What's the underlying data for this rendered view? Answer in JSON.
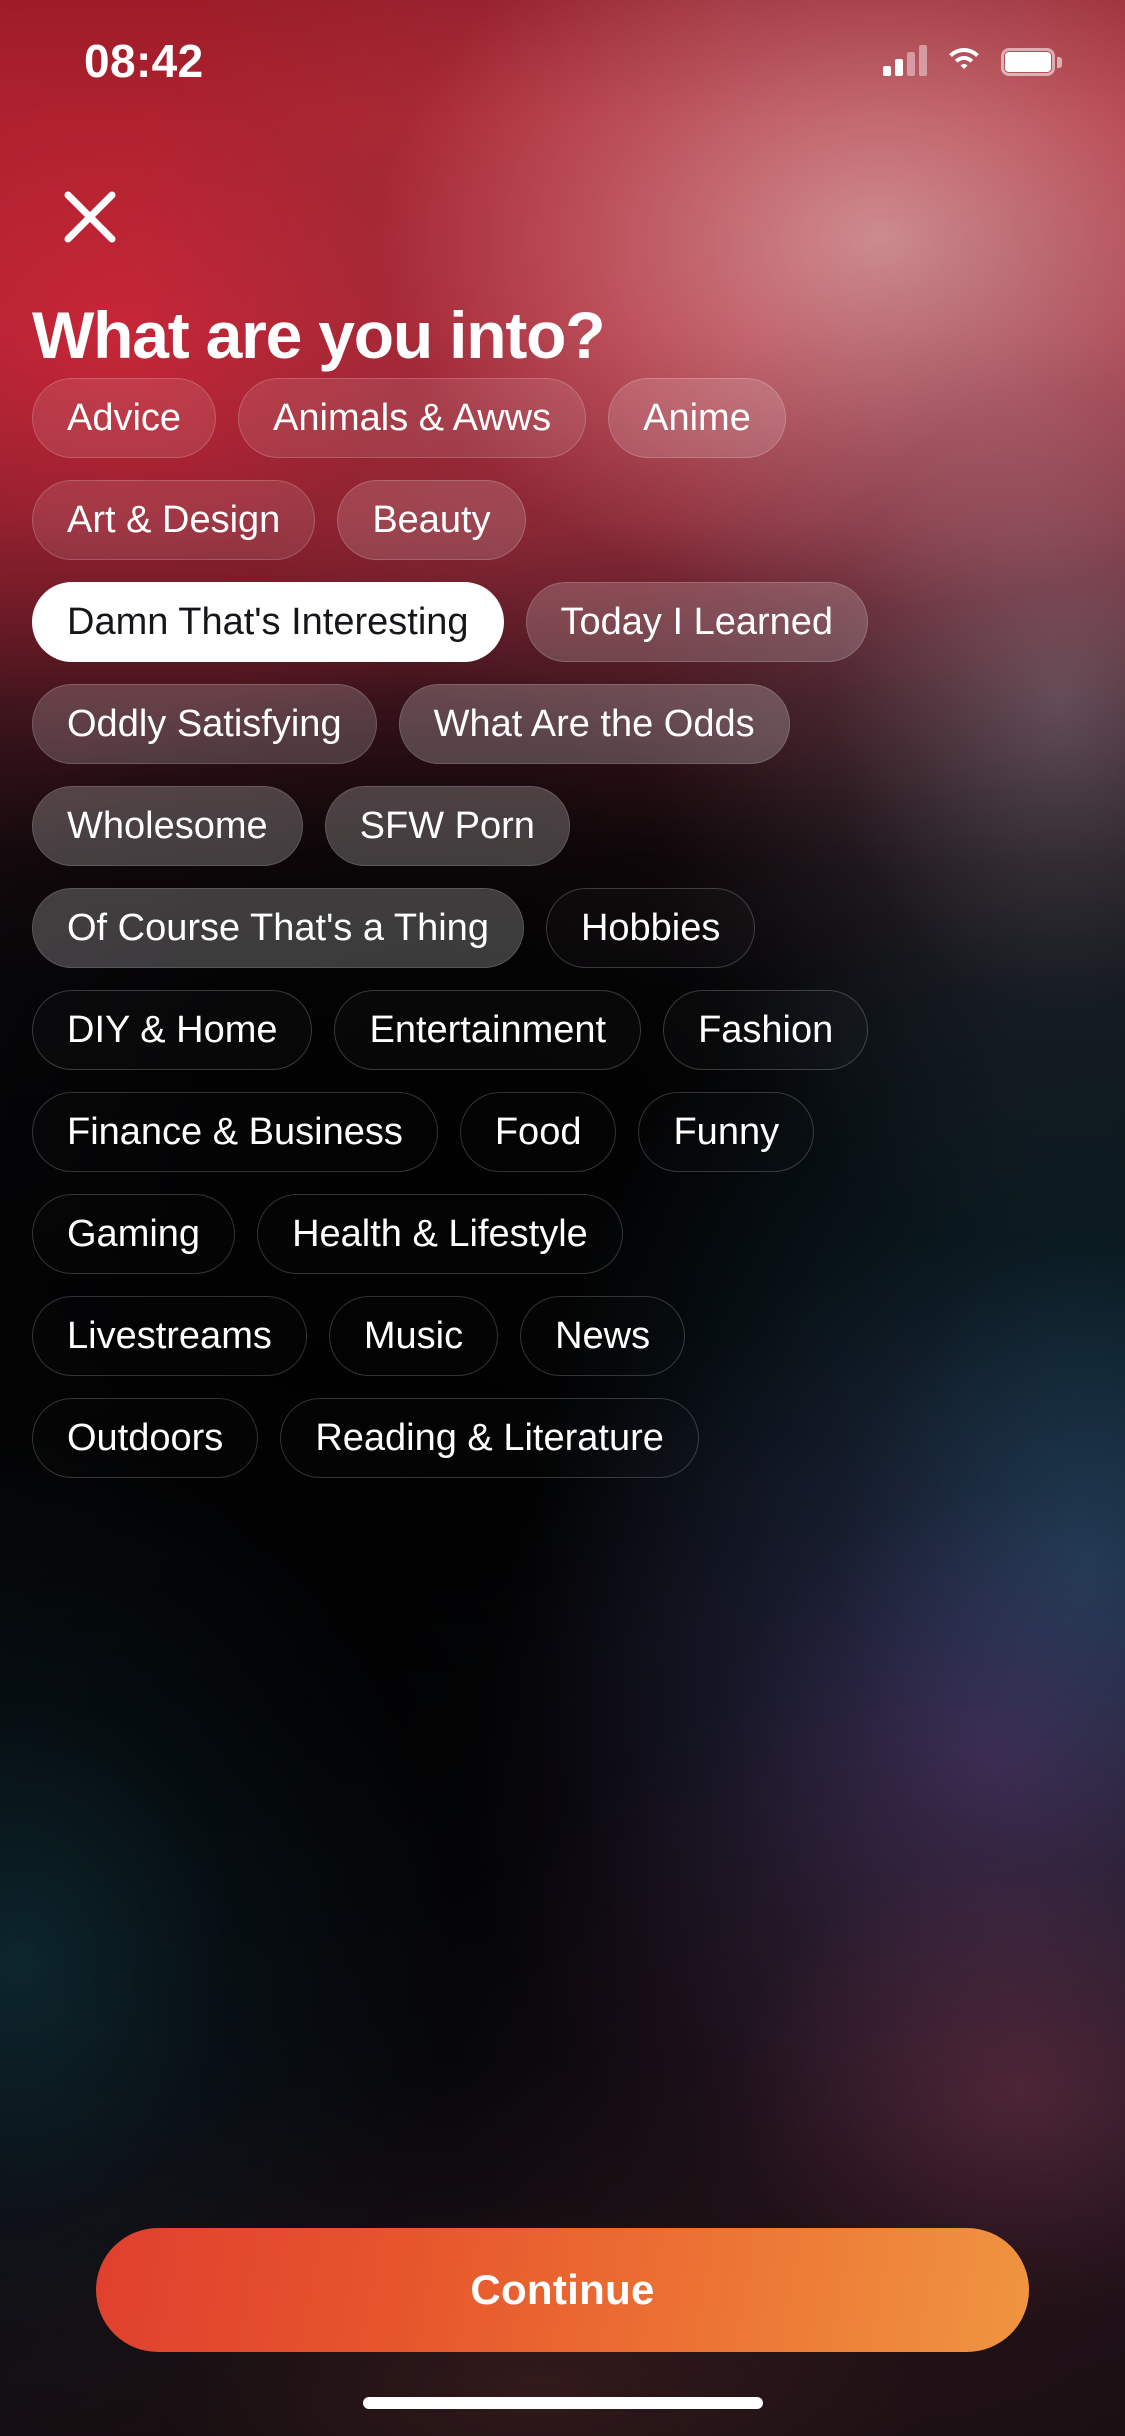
{
  "status_bar": {
    "time": "08:42",
    "cellular_icon": "signal-bars-icon",
    "wifi_icon": "wifi-icon",
    "battery_icon": "battery-full-icon"
  },
  "header": {
    "close_icon": "close-icon",
    "title": "What are you into?"
  },
  "interests": {
    "rows": [
      [
        {
          "label": "Advice",
          "selected": false,
          "fill": "f10"
        },
        {
          "label": "Animals & Awws",
          "selected": false,
          "fill": "f10"
        },
        {
          "label": "Anime",
          "selected": false,
          "fill": "f14"
        }
      ],
      [
        {
          "label": "Art & Design",
          "selected": false,
          "fill": "f10"
        },
        {
          "label": "Beauty",
          "selected": false,
          "fill": "f14"
        }
      ],
      [
        {
          "label": "Damn That's Interesting",
          "selected": true,
          "fill": "selected"
        },
        {
          "label": "Today I Learned",
          "selected": false,
          "fill": "f18"
        }
      ],
      [
        {
          "label": "Oddly Satisfying",
          "selected": false,
          "fill": "f18"
        },
        {
          "label": "What Are the Odds",
          "selected": false,
          "fill": "f22"
        }
      ],
      [
        {
          "label": "Wholesome",
          "selected": false,
          "fill": "f22"
        },
        {
          "label": "SFW Porn",
          "selected": false,
          "fill": "f22"
        }
      ],
      [
        {
          "label": "Of Course That's a Thing",
          "selected": false,
          "fill": "f22"
        },
        {
          "label": "Hobbies",
          "selected": false,
          "fill": "f02"
        }
      ],
      [
        {
          "label": "DIY & Home",
          "selected": false,
          "fill": "f02"
        },
        {
          "label": "Entertainment",
          "selected": false,
          "fill": "f02"
        },
        {
          "label": "Fashion",
          "selected": false,
          "fill": "f02"
        }
      ],
      [
        {
          "label": "Finance & Business",
          "selected": false,
          "fill": "f01"
        },
        {
          "label": "Food",
          "selected": false,
          "fill": "f01"
        },
        {
          "label": "Funny",
          "selected": false,
          "fill": "f01"
        }
      ],
      [
        {
          "label": "Gaming",
          "selected": false,
          "fill": "f01"
        },
        {
          "label": "Health & Lifestyle",
          "selected": false,
          "fill": "f01"
        }
      ],
      [
        {
          "label": "Livestreams",
          "selected": false,
          "fill": "f01"
        },
        {
          "label": "Music",
          "selected": false,
          "fill": "f01"
        },
        {
          "label": "News",
          "selected": false,
          "fill": "f01"
        }
      ],
      [
        {
          "label": "Outdoors",
          "selected": false,
          "fill": "f01"
        },
        {
          "label": "Reading & Literature",
          "selected": false,
          "fill": "f01"
        }
      ]
    ]
  },
  "footer": {
    "continue_label": "Continue",
    "home_indicator": "home-indicator"
  },
  "colors": {
    "accent_start": "#e0402e",
    "accent_end": "#ef9540",
    "selected_chip_bg": "#ffffff",
    "selected_chip_text": "#16161a",
    "chip_text": "#ffffff"
  }
}
